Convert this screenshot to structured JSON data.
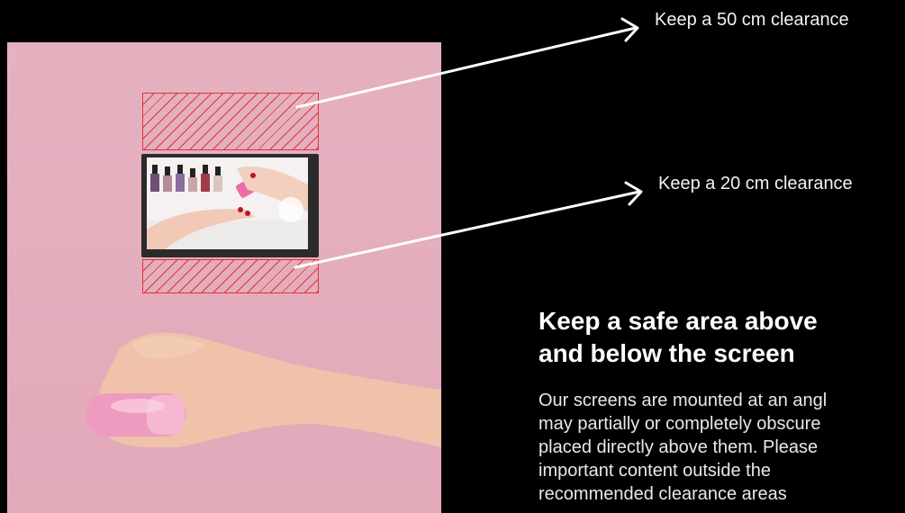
{
  "annotations": {
    "top_clearance": "Keep a 50 cm clearance",
    "bottom_clearance": "Keep a 20 cm clearance"
  },
  "heading": {
    "line1": "Keep a safe area above",
    "line2": "and below the screen"
  },
  "body": {
    "line1": "Our screens are mounted at an angl",
    "line2": "may partially or completely obscure",
    "line3": "placed directly above them. Please",
    "line4": "important content outside the",
    "line5": "recommended clearance areas"
  },
  "colors": {
    "background": "#000000",
    "panel_pink": "#e5b1bf",
    "hatch_red": "#e0323a"
  }
}
